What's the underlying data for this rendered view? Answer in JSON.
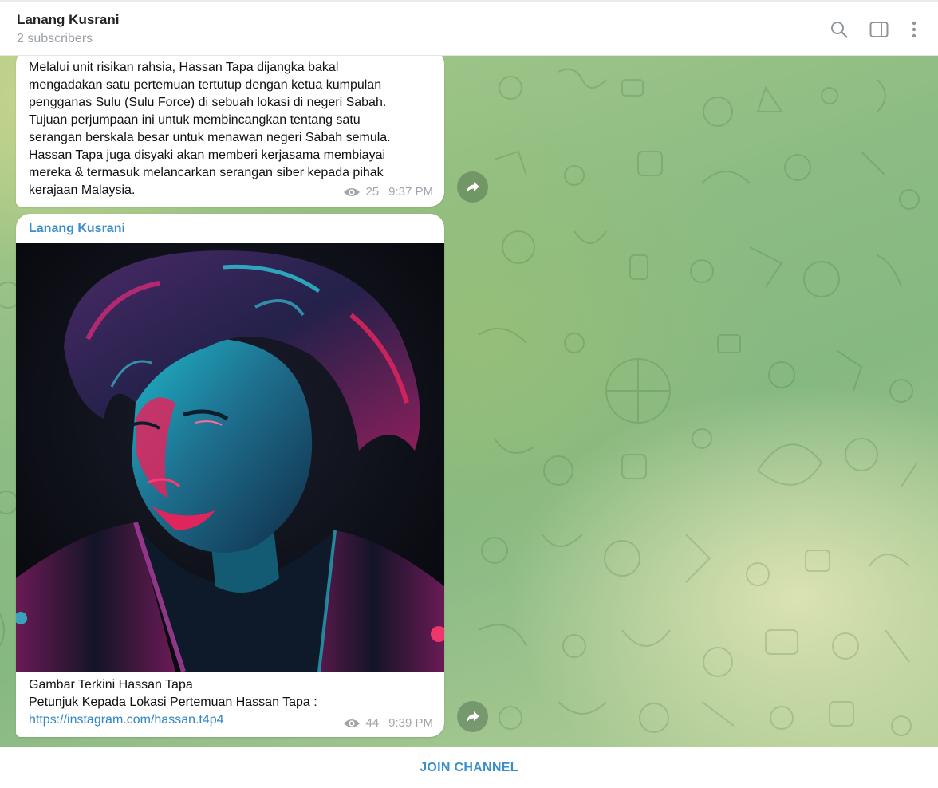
{
  "header": {
    "title": "Lanang Kusrani",
    "subtitle": "2 subscribers",
    "icons": [
      "search-icon",
      "sidebar-toggle-icon",
      "more-vertical-icon"
    ]
  },
  "messages": [
    {
      "text_lines": [
        "Melalui unit risikan rahsia, Hassan Tapa dijangka bakal",
        "mengadakan satu pertemuan tertutup dengan ketua kumpulan",
        "pengganas Sulu (Sulu Force) di sebuah lokasi di negeri Sabah.",
        "Tujuan perjumpaan ini untuk membincangkan tentang satu",
        "serangan berskala besar untuk menawan negeri Sabah semula.",
        "Hassan Tapa juga disyaki akan memberi kerjasama membiayai",
        "mereka & termasuk melancarkan serangan siber kepada pihak",
        "kerajaan Malaysia."
      ],
      "views": "25",
      "time": "9:37 PM"
    },
    {
      "author": "Lanang Kusrani",
      "caption_line1": "Gambar Terkini Hassan Tapa",
      "caption_line2": "Petunjuk Kepada Lokasi Pertemuan Hassan Tapa :",
      "link": "https://instagram.com/hassan.t4p4",
      "views": "44",
      "time": "9:39 PM"
    }
  ],
  "footer": {
    "join_label": "JOIN CHANNEL"
  },
  "colors": {
    "accent": "#3a8fc6",
    "chat_bg": "#8cbc83"
  }
}
